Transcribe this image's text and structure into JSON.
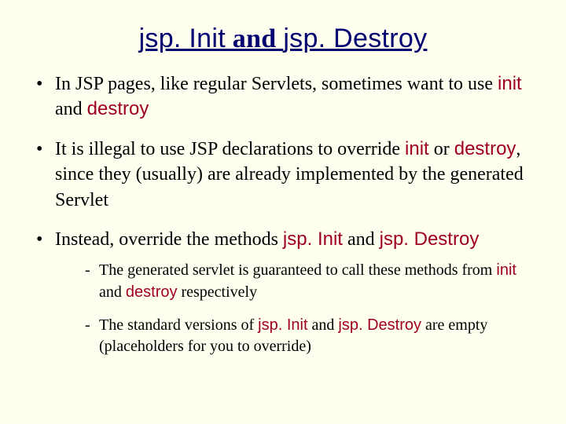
{
  "title": {
    "pre": "jsp. Init",
    "mid": " and ",
    "post": "jsp. Destroy"
  },
  "bullets": [
    {
      "parts": [
        {
          "t": "In JSP pages, like regular Servlets, sometimes want to use "
        },
        {
          "t": "init",
          "code": true
        },
        {
          "t": " and "
        },
        {
          "t": "destroy",
          "code": true
        }
      ]
    },
    {
      "parts": [
        {
          "t": "It is illegal to use JSP declarations to override "
        },
        {
          "t": "init",
          "code": true
        },
        {
          "t": " or "
        },
        {
          "t": "destroy",
          "code": true
        },
        {
          "t": ", since they (usually) are already implemented by the generated Servlet"
        }
      ]
    },
    {
      "parts": [
        {
          "t": "Instead, override the methods "
        },
        {
          "t": "jsp. Init",
          "code": true
        },
        {
          "t": " and "
        },
        {
          "t": "jsp. Destroy",
          "code": true
        }
      ],
      "sub": [
        {
          "parts": [
            {
              "t": "The generated servlet is guaranteed to call these methods from "
            },
            {
              "t": "init",
              "code": true
            },
            {
              "t": " and "
            },
            {
              "t": "destroy",
              "code": true
            },
            {
              "t": " respectively"
            }
          ]
        },
        {
          "parts": [
            {
              "t": "The standard versions of "
            },
            {
              "t": "jsp. Init",
              "code": true
            },
            {
              "t": " and "
            },
            {
              "t": "jsp. Destroy",
              "code": true
            },
            {
              "t": " are empty (placeholders for you to override)"
            }
          ]
        }
      ]
    }
  ]
}
